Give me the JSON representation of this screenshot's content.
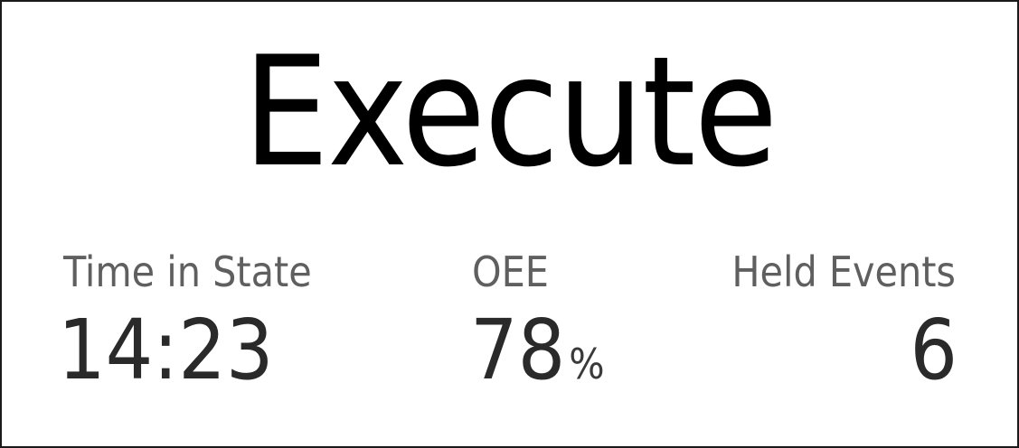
{
  "state": {
    "label": "Execute"
  },
  "metrics": {
    "time_in_state": {
      "label": "Time in State",
      "value": "14:23"
    },
    "oee": {
      "label": "OEE",
      "value": "78",
      "unit": "%"
    },
    "held_events": {
      "label": "Held Events",
      "value": "6"
    }
  }
}
